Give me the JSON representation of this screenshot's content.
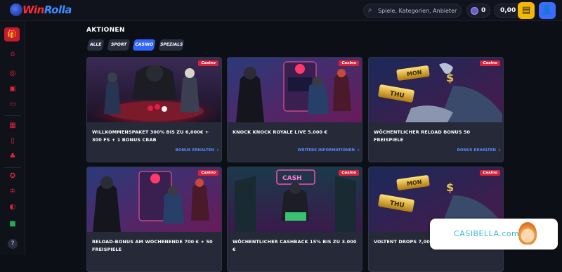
{
  "header": {
    "logo_win": "Win",
    "logo_rolla": "Rolla",
    "search_placeholder": "Spiele, Kategorien, Anbieter",
    "coins": "0",
    "balance": "0,00 €"
  },
  "page": {
    "title": "AKTIONEN",
    "filters": [
      {
        "label": "ALLE",
        "active": false
      },
      {
        "label": "SPORT",
        "active": false
      },
      {
        "label": "CASINO",
        "active": true
      },
      {
        "label": "SPEZIALS",
        "active": false
      }
    ]
  },
  "cards": [
    {
      "tag": "Casino",
      "title": "WILLKOMMENSPAKET 300% BIS ZU 6,000€ + 300 FS + 1 BONUS CRAB",
      "cta": "BONUS ERHALTEN"
    },
    {
      "tag": "Casino",
      "title": "KNOCK KNOCK ROYALE LIVE 5.000 €",
      "cta": "WEITERE INFORMATIONEN"
    },
    {
      "tag": "Casino",
      "title": "WÖCHENTLICHER RELOAD BONUS 50 FREISPIELE",
      "cta": "BONUS ERHALTEN"
    },
    {
      "tag": "Casino",
      "title": "RELOAD-BONUS AM WOCHENENDE 700 € + 50 FREISPIELE",
      "cta": ""
    },
    {
      "tag": "Casino",
      "title": "WÖCHENTLICHER CASHBACK 15% BIS ZU 3.000 €",
      "cta": ""
    },
    {
      "tag": "Casino",
      "title": "VOLTENT DROPS 7,000,000€",
      "cta": ""
    }
  ],
  "overlay": {
    "text": "CASIBELLA.com"
  },
  "colors": {
    "accent": "#2f64ff",
    "brand_red": "#e6243a",
    "tag_red": "#d8233a"
  }
}
